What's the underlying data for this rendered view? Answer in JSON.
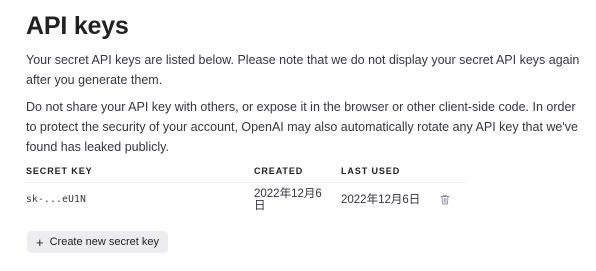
{
  "page": {
    "title": "API keys",
    "description_1": "Your secret API keys are listed below. Please note that we do not display your secret API keys again after you generate them.",
    "description_2": "Do not share your API key with others, or expose it in the browser or other client-side code. In order to protect the security of your account, OpenAI may also automatically rotate any API key that we've found has leaked publicly."
  },
  "table": {
    "headers": {
      "secret_key": "SECRET KEY",
      "created": "CREATED",
      "last_used": "LAST USED"
    },
    "rows": [
      {
        "secret_key": "sk-...eU1N",
        "created": "2022年12月6日",
        "last_used": "2022年12月6日",
        "action_icon": "trash-icon"
      }
    ]
  },
  "actions": {
    "create_icon": "+",
    "create_label": "Create new secret key"
  }
}
